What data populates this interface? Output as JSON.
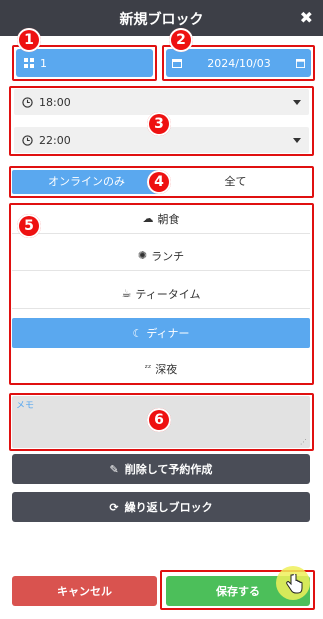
{
  "header": {
    "title": "新規ブロック"
  },
  "markers": [
    "1",
    "2",
    "3",
    "4",
    "5",
    "6"
  ],
  "people": {
    "value": "1"
  },
  "date": {
    "value": "2024/10/03"
  },
  "times": {
    "start": "18:00",
    "end": "22:00"
  },
  "filter": {
    "online_only": "オンラインのみ",
    "all": "全て"
  },
  "meals": [
    {
      "icon": "☁",
      "label": "朝食"
    },
    {
      "icon": "✺",
      "label": "ランチ"
    },
    {
      "icon": "☕",
      "label": "ティータイム"
    },
    {
      "icon": "☾",
      "label": "ディナー"
    },
    {
      "icon": "ᶻᶻ",
      "label": "深夜"
    }
  ],
  "memo": {
    "placeholder": "メモ"
  },
  "actions": {
    "delete_and_reserve": "削除して予約作成",
    "repeat_block": "繰り返しブロック",
    "cancel": "キャンセル",
    "save": "保存する"
  },
  "colors": {
    "header": "#3d3f47",
    "accent_blue": "#5aa8ef",
    "dark_button": "#4a4d57",
    "cancel": "#d9534f",
    "save": "#4cbf5a",
    "highlight_red": "#e01010"
  }
}
